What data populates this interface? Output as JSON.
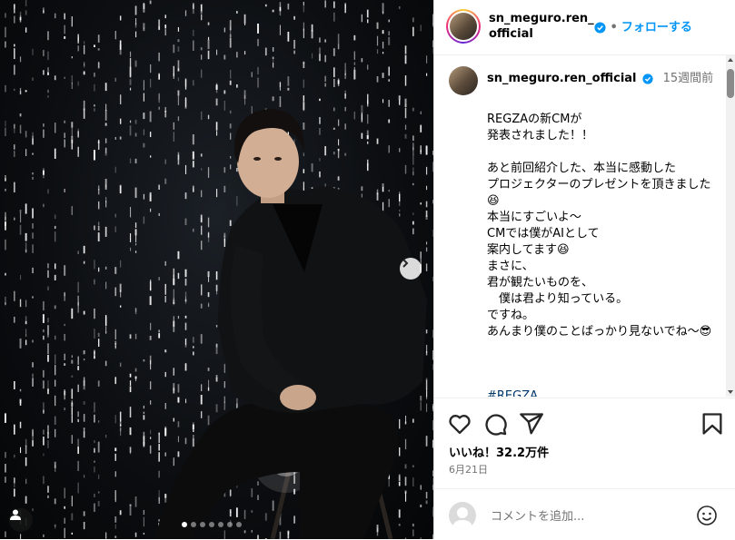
{
  "colors": {
    "accent": "#0095f6",
    "verified": "#0095f6",
    "secondary_text": "#737373",
    "hashtag": "#00376b"
  },
  "header": {
    "username": "sn_meguro.ren_official",
    "separator": "•",
    "follow_label": "フォローする"
  },
  "post": {
    "author": "sn_meguro.ren_official",
    "time_ago": "15週間前",
    "caption": "REGZAの新CMが\n発表されました！！\n\nあと前回紹介した、本当に感動した\nプロジェクターのプレゼントを頂きました😆\n本当にすごいよ〜\nCMでは僕がAIとして\n案内してます😆\nまさに、\n君が観たいものを、\n　僕は君より知っている。\nですね。\nあんまり僕のことばっかり見ないでね〜😎",
    "hashtag": "#REGZA"
  },
  "media": {
    "icons": [
      "next-chevron-icon",
      "user-tag-icon"
    ],
    "carousel_count": 7,
    "carousel_active": 0
  },
  "actions": {
    "icons": [
      "heart-icon",
      "comment-icon",
      "share-icon",
      "bookmark-icon"
    ],
    "likes": "いいね！32.2万件",
    "date": "6月21日"
  },
  "comment_box": {
    "placeholder": "コメントを追加...",
    "icons": [
      "avatar-placeholder-icon",
      "emoji-icon"
    ]
  }
}
